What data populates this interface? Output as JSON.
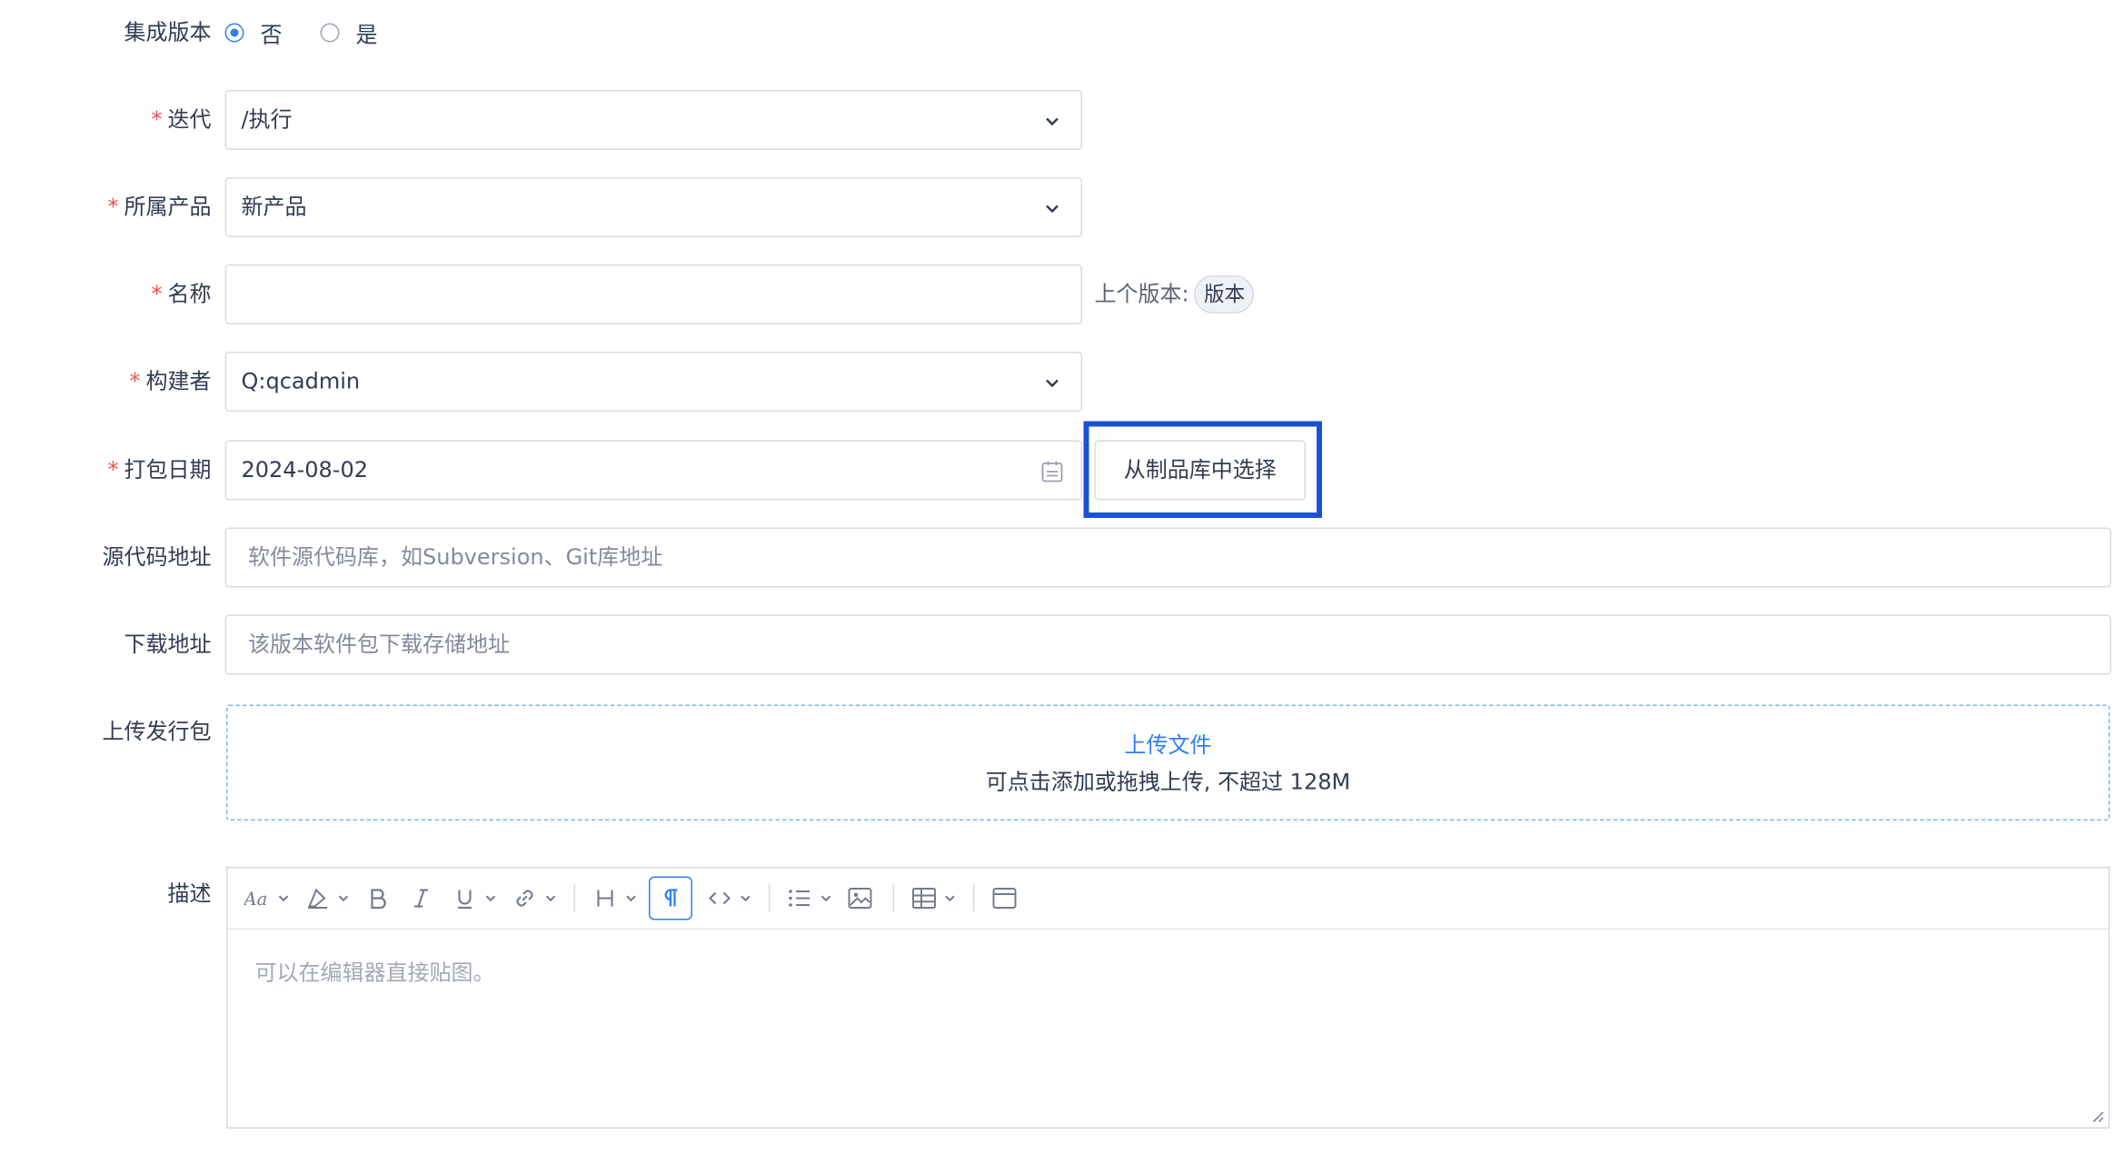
{
  "integrated": {
    "label": "集成版本",
    "options": [
      "否",
      "是"
    ],
    "selected": "否"
  },
  "iteration": {
    "label": "迭代",
    "value": "/执行"
  },
  "product": {
    "label": "所属产品",
    "value": "新产品"
  },
  "name": {
    "label": "名称",
    "value": "",
    "prev_label": "上个版本:",
    "prev_value": "版本"
  },
  "builder": {
    "label": "构建者",
    "value": "Q:qcadmin"
  },
  "date": {
    "label": "打包日期",
    "value": "2024-08-02",
    "pick_button": "从制品库中选择"
  },
  "source": {
    "label": "源代码地址",
    "placeholder": "软件源代码库，如Subversion、Git库地址"
  },
  "download": {
    "label": "下载地址",
    "placeholder": "该版本软件包下载存储地址"
  },
  "upload": {
    "label": "上传发行包",
    "link": "上传文件",
    "hint": "可点击添加或拖拽上传, 不超过 128M"
  },
  "description": {
    "label": "描述",
    "placeholder": "可以在编辑器直接贴图。",
    "toolbar": [
      "font-size-icon",
      "paint-icon",
      "bold-icon",
      "italic-icon",
      "underline-icon",
      "link-icon",
      "heading-icon",
      "paragraph-icon",
      "code-icon",
      "list-icon",
      "image-icon",
      "table-icon",
      "panel-icon"
    ]
  },
  "required_mark": "*",
  "colors": {
    "accent": "#2e7ff3",
    "highlight": "#1a52d6",
    "required": "#eb5050"
  }
}
